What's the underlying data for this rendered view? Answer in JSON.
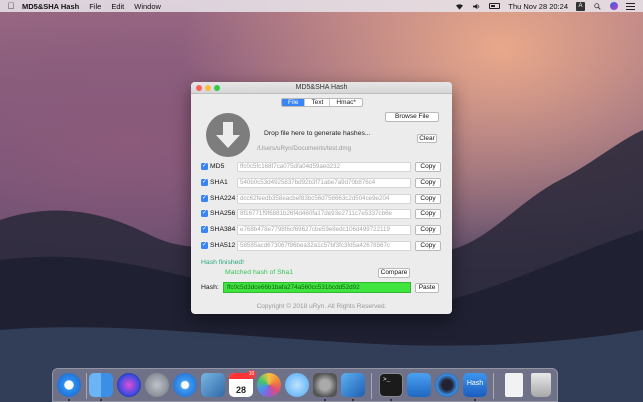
{
  "menubar": {
    "app_name": "MD5&SHA Hash",
    "menus": [
      "File",
      "Edit",
      "Window"
    ],
    "clock": "Thu Nov 28  20:24",
    "input_source": "A"
  },
  "window": {
    "title": "MD5&SHA Hash",
    "tabs": [
      {
        "label": "File",
        "active": true
      },
      {
        "label": "Text",
        "active": false
      },
      {
        "label": "Hmac*",
        "active": false
      }
    ],
    "drop": {
      "prompt": "Drop file here to generate hashes...",
      "path": "/Users/uRyn/Documents/test.dmg",
      "browse_label": "Browse File",
      "clear_label": "Clear"
    },
    "hashes": [
      {
        "algo": "MD5",
        "value": "ffc0c5fc168f7ca075dfa04d59aed232",
        "checked": true,
        "copy_label": "Copy"
      },
      {
        "algo": "SHA1",
        "value": "540b0c53d4925837bd92b3f71abe7a9d70b876c4",
        "checked": true,
        "copy_label": "Copy"
      },
      {
        "algo": "SHA224",
        "value": "dcc62feedb358eacbef83bc56d756663c2d504ce9e204",
        "checked": true,
        "copy_label": "Copy"
      },
      {
        "algo": "SHA256",
        "value": "8f16771f9f6881b26f4d460fa17de93e2711c7e5337cb6e",
        "checked": true,
        "copy_label": "Copy"
      },
      {
        "algo": "SHA384",
        "value": "e768b478e7798f6cf69627cbe59e8edc106d499722119",
        "checked": true,
        "copy_label": "Copy"
      },
      {
        "algo": "SHA512",
        "value": "58585acd673067f96bea32a1c57bf3fc3fd5a42678567c",
        "checked": true,
        "copy_label": "Copy"
      }
    ],
    "status": "Hash finished!",
    "match": "Matched hash of Sha1",
    "compare_label": "Compare",
    "hash_label": "Hash:",
    "hash_value": "ffc0c5d3dce66b1bafa274a560cc531bcdd52d92",
    "paste_label": "Paste",
    "copyright": "Copyright © 2018 uRyn. All Rights Reserved.",
    "colors": {
      "accent": "#3a85f6",
      "success": "#3fe43f",
      "status": "#2aa87c"
    }
  },
  "dock": {
    "apps": [
      "safari",
      "finder",
      "siri",
      "launchpad",
      "safari-2",
      "preview",
      "calendar",
      "photos",
      "messages",
      "system-preferences",
      "xcode",
      "terminal",
      "keynote",
      "quicktime",
      "hash",
      "document",
      "trash"
    ],
    "calendar_day": "28",
    "calendar_badge": "10",
    "hash_app_label": "Hash"
  }
}
